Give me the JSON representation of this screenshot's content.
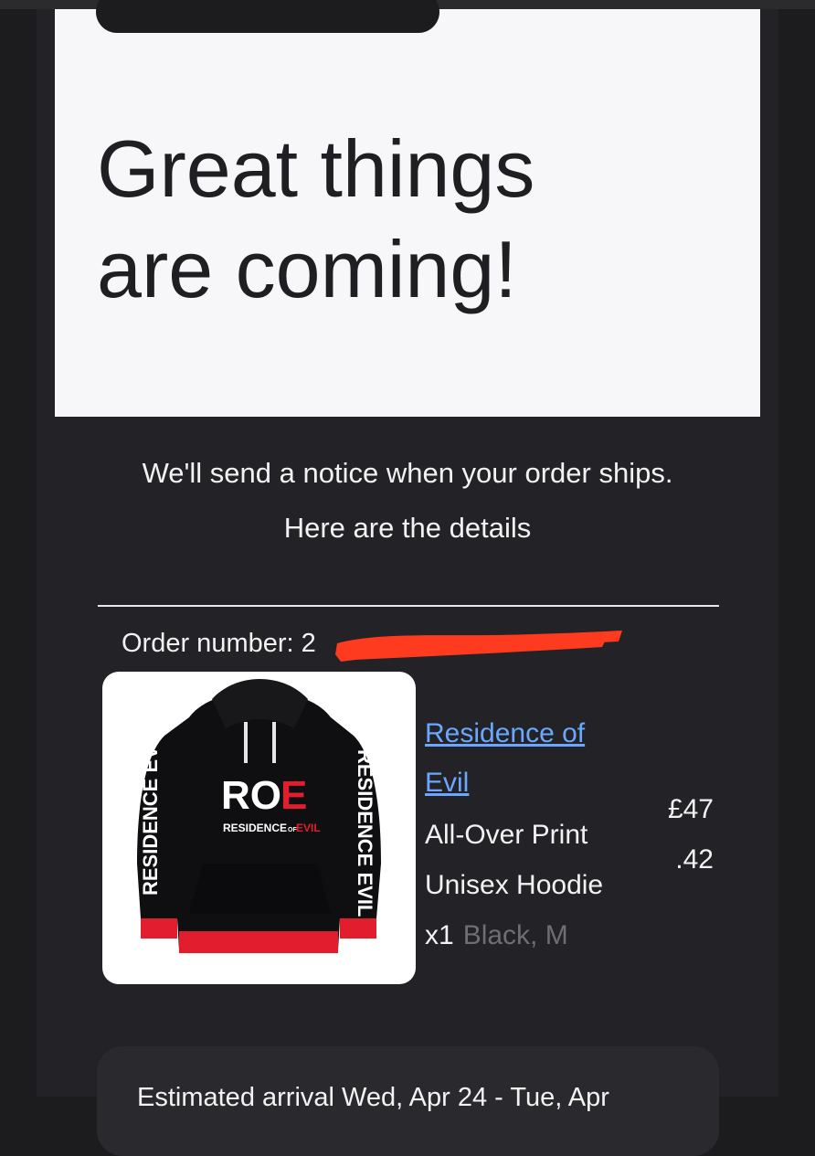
{
  "hero": {
    "headline_line1": "Great things",
    "headline_line2": "are coming!"
  },
  "notice": {
    "line1": "We'll send a notice when your order ships.",
    "line2": "Here are the details"
  },
  "order": {
    "label": "Order number:",
    "value": "2"
  },
  "product": {
    "title_line1": "Residence of",
    "title_line2": "Evil",
    "desc_line1": "All-Over Print",
    "desc_line2": "Unisex Hoodie",
    "quantity": "x1",
    "variant": "Black, M",
    "price_line1": "£47",
    "price_line2": ".42",
    "hoodie_print": {
      "logo_left": "RO",
      "logo_right": "E",
      "sub_left": "RESIDENCE",
      "sub_small": "OF",
      "sub_right": "EVIL",
      "sleeve_left": "RESIDENCE EVIL",
      "sleeve_right": "RESIDENCE EVIL"
    }
  },
  "arrival": {
    "text": "Estimated arrival Wed, Apr 24 - Tue, Apr"
  },
  "colors": {
    "background": "#1c1c1e",
    "panel": "#232327",
    "hero": "#f7f7f9",
    "link": "#6aa7ff",
    "redaction": "#ff3b1f",
    "hoodie_red": "#e11d2e"
  }
}
